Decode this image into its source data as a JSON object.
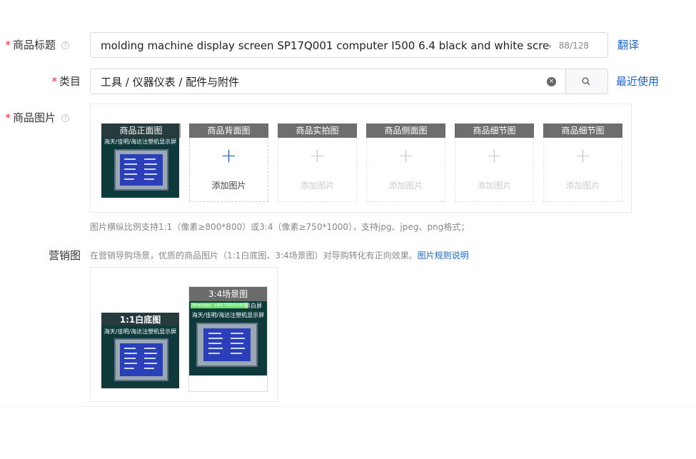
{
  "title_field": {
    "label": "商品标题",
    "value": "molding machine display screen SP17Q001 computer I500 6.4 black and white screen displa",
    "count": "88/128",
    "translate_label": "翻译"
  },
  "category_field": {
    "label": "类目",
    "value": "工具 / 仪器仪表 / 配件与附件",
    "recent_label": "最近使用"
  },
  "product_images": {
    "label": "商品图片",
    "slots": [
      {
        "caption": "商品正面图"
      },
      {
        "caption": "商品背面图",
        "add_label": "添加图片"
      },
      {
        "caption": "商品实拍图",
        "add_label": "添加图片"
      },
      {
        "caption": "商品侧面图",
        "add_label": "添加图片"
      },
      {
        "caption": "商品细节图",
        "add_label": "添加图片"
      },
      {
        "caption": "商品细节图",
        "add_label": "添加图片"
      }
    ],
    "photo_text": "海天/佳明/海达注塑机显示屏",
    "hint": "图片横纵比例支持1:1（像素≥800*800）或3:4（像素≥750*1000），支持jpg、jpeg、png格式；"
  },
  "marketing": {
    "label": "营销图",
    "desc": "在营销导购场景，优质的商品图片（1:1白底图、3:4场景图）对导购转化有正向效果。",
    "rules_link": "图片规则说明",
    "images": [
      {
        "caption": "1:1白底图"
      },
      {
        "caption": "3:4场景图",
        "badge": "WhatsApp：+8617302910925",
        "badge_suffix": "黑白屏"
      }
    ]
  },
  "icons": {
    "help": "?",
    "clear": "×",
    "plus": "+",
    "search": "search-icon"
  }
}
